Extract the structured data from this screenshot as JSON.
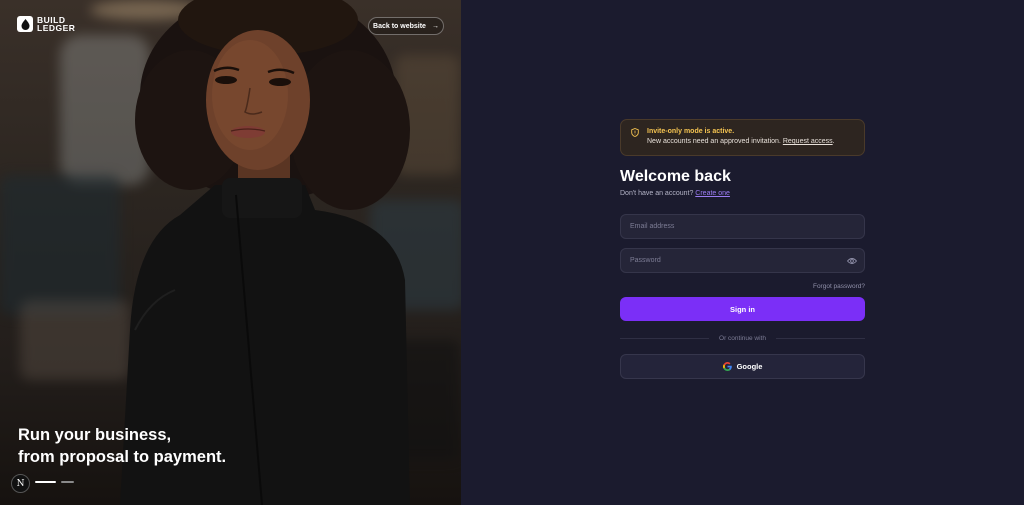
{
  "brand": {
    "line1": "BUILD",
    "line2": "LEDGER"
  },
  "header": {
    "back_label": "Back to website",
    "back_arrow": "→"
  },
  "hero": {
    "tagline_line1": "Run your business,",
    "tagline_line2": "from proposal to payment.",
    "badge": "N"
  },
  "alert": {
    "title": "Invite-only mode is active.",
    "body_prefix": "New accounts need an approved invitation.",
    "link": "Request access",
    "suffix": "."
  },
  "login": {
    "title": "Welcome back",
    "no_account": "Don't have an account?",
    "create_link": "Create one",
    "email_placeholder": "Email address",
    "password_placeholder": "Password",
    "forgot": "Forgot password?",
    "signin": "Sign in",
    "divider": "Or continue with",
    "google": "Google"
  },
  "colors": {
    "accent": "#7b2ff7",
    "alert_title": "#f5c451",
    "link": "#9b7cf2",
    "panel_bg": "#1b1b2e"
  },
  "icons": [
    "logo-mark-icon",
    "arrow-right-icon",
    "shield-icon",
    "eye-icon",
    "google-icon"
  ]
}
